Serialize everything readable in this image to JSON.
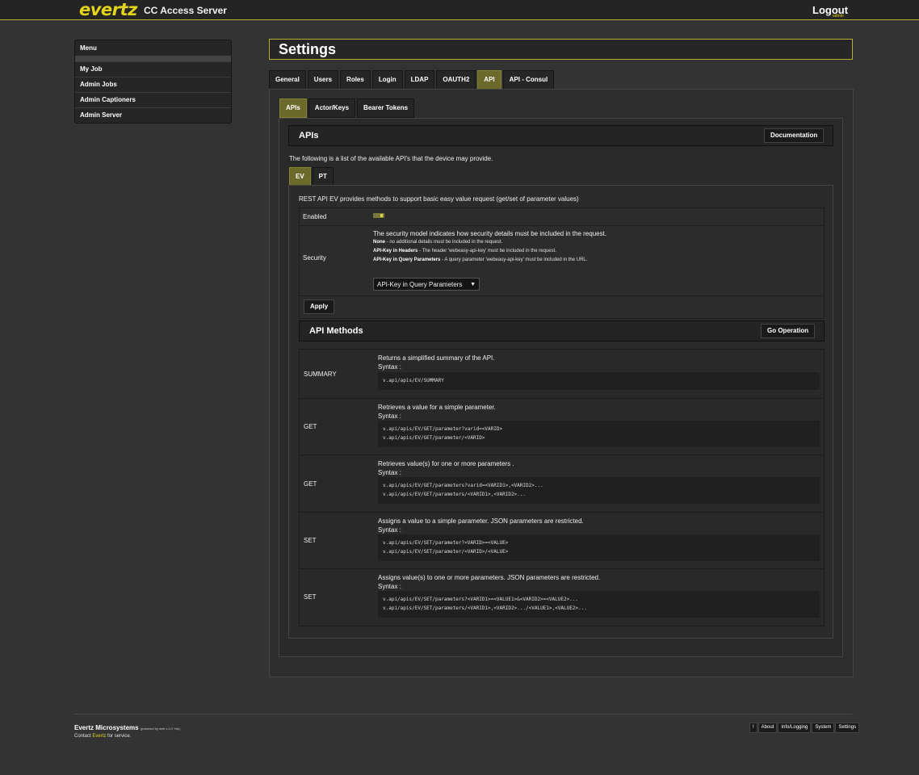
{
  "header": {
    "logo": "evertz",
    "app_title": "CC Access Server",
    "logout": "Logout",
    "user": "admin"
  },
  "menu": {
    "title": "Menu",
    "items": [
      {
        "label": "My Job"
      },
      {
        "label": "Admin Jobs"
      },
      {
        "label": "Admin Captioners"
      },
      {
        "label": "Admin Server"
      }
    ]
  },
  "page_title": "Settings",
  "main_tabs": [
    {
      "label": "General"
    },
    {
      "label": "Users"
    },
    {
      "label": "Roles"
    },
    {
      "label": "Login"
    },
    {
      "label": "LDAP"
    },
    {
      "label": "OAUTH2"
    },
    {
      "label": "API",
      "active": true
    },
    {
      "label": "API - Consul"
    }
  ],
  "sub_tabs": [
    {
      "label": "APIs",
      "active": true
    },
    {
      "label": "Actor/Keys"
    },
    {
      "label": "Bearer Tokens"
    }
  ],
  "apis": {
    "title": "APIs",
    "doc_button": "Documentation",
    "intro": "The following is a list of the available API's that the device may provide.",
    "api_tabs": [
      {
        "label": "EV",
        "active": true
      },
      {
        "label": "PT"
      }
    ],
    "ev_description": "REST API EV provides methods to support basic easy value request (get/set of parameter values)",
    "enabled_label": "Enabled",
    "enabled": true,
    "security_label": "Security",
    "security_intro": "The security model indicates how security details must be included in the request.",
    "security_notes": [
      {
        "term": "None",
        "text": " - no additional details must be included in the request."
      },
      {
        "term": "API-Key in Headers",
        "text": " - The header 'webeasy-api-key' must be included in the request."
      },
      {
        "term": "API-Key in Query Parameters",
        "text": " - A query parameter 'webeasy-api-key' must be included in the URL."
      }
    ],
    "security_value": "API-Key in Query Parameters",
    "apply_button": "Apply"
  },
  "api_methods": {
    "title": "API Methods",
    "go_button": "Go Operation",
    "syntax_label": "Syntax :",
    "rows": [
      {
        "name": "SUMMARY",
        "desc": "Returns a simplified summary of the API.",
        "code": [
          "v.api/apis/EV/SUMMARY"
        ]
      },
      {
        "name": "GET",
        "desc": "Retrieves a value for a simple parameter.",
        "code": [
          "v.api/apis/EV/GET/parameter?varid=<VARID>",
          "v.api/apis/EV/GET/parameter/<VARID>"
        ]
      },
      {
        "name": "GET",
        "desc": "Retrieves value(s) for one or more parameters .",
        "code": [
          "v.api/apis/EV/GET/parameters?varid=<VARID1>,<VARID2>...",
          "v.api/apis/EV/GET/parameters/<VARID1>,<VARID2>..."
        ]
      },
      {
        "name": "SET",
        "desc": "Assigns a value to a simple parameter. JSON parameters are restricted.",
        "code": [
          "v.api/apis/EV/SET/parameter?<VARID>=<VALUE>",
          "v.api/apis/EV/SET/parameter/<VARID>/<VALUE>"
        ]
      },
      {
        "name": "SET",
        "desc": "Assigns value(s) to one or more parameters. JSON parameters are restricted.",
        "code": [
          "v.api/apis/EV/SET/parameters?<VARID1>=<VALUE1>&<VARID2>=<VALUE2>...",
          "v.api/apis/EV/SET/parameters/<VARID1>,<VARID2>.../<VALUE1>,<VALUE2>..."
        ]
      }
    ]
  },
  "footer": {
    "company": "Evertz Microsystems",
    "powered": "(powered by web v.1.0 +ds)",
    "contact_prefix": "Contact",
    "contact_link": "Evertz",
    "contact_suffix": "for service.",
    "links": [
      {
        "label": "!"
      },
      {
        "label": "About"
      },
      {
        "label": "Info/Logging"
      },
      {
        "label": "System"
      },
      {
        "label": "Settings"
      }
    ]
  }
}
